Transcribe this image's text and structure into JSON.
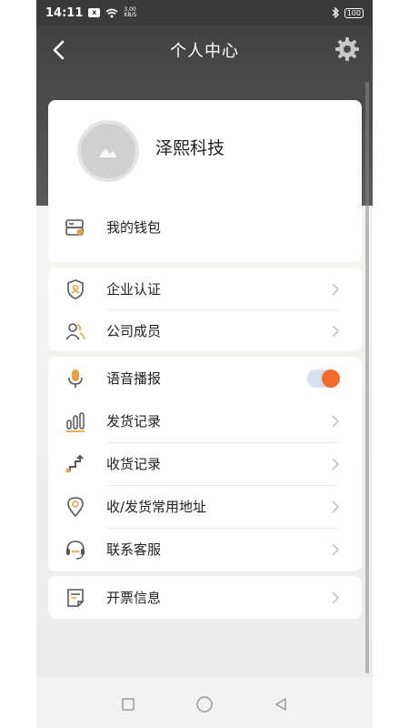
{
  "status_bar": {
    "time": "14:11",
    "notification_badge": "x",
    "speed_value": "3.00",
    "speed_unit": "KB/S",
    "battery": "100"
  },
  "header": {
    "title": "个人中心"
  },
  "profile": {
    "company_name": "泽熙科技"
  },
  "menu": {
    "wallet": "我的钱包",
    "enterprise_auth": "企业认证",
    "company_members": "公司成员",
    "voice_broadcast": "语音播报",
    "voice_broadcast_on": true,
    "shipping_records": "发货记录",
    "receiving_records": "收货记录",
    "addresses": "收/发货常用地址",
    "customer_service": "联系客服",
    "invoice_info": "开票信息"
  },
  "colors": {
    "accent": "#f26a2a",
    "icon_gold": "#e6a23c",
    "header_bg": "#424242"
  }
}
